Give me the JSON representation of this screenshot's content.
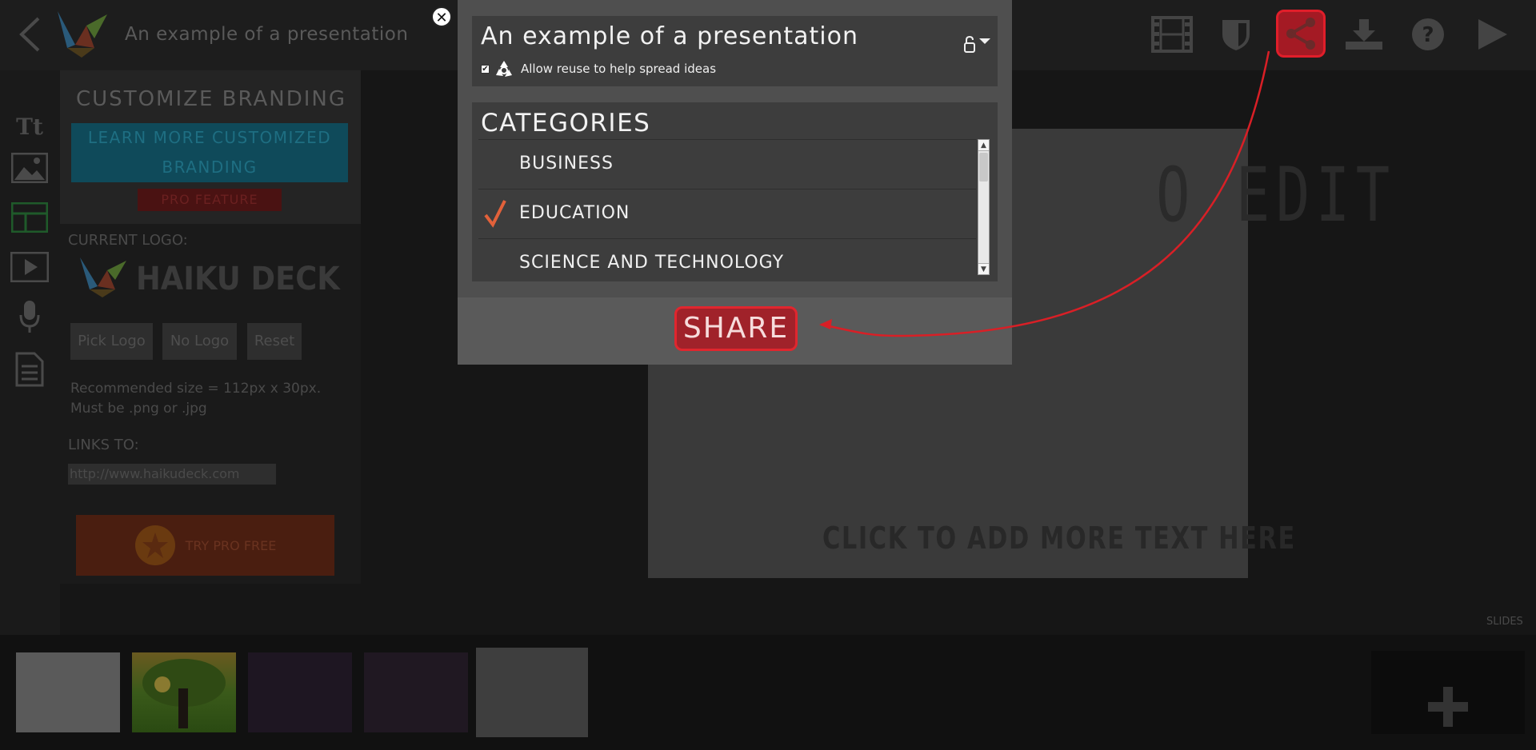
{
  "header": {
    "title": "An example of a presentation",
    "icons": [
      "back-icon",
      "haiku-deck-logo",
      "film-strip-icon",
      "pro-shield-icon",
      "share-icon",
      "download-icon",
      "help-icon",
      "play-icon"
    ]
  },
  "branding": {
    "title": "CUSTOMIZE BRANDING",
    "learn_more": "LEARN MORE CUSTOMIZED BRANDING",
    "pro_feature": "PRO FEATURE",
    "current_logo_label": "CURRENT LOGO:",
    "logo_text": "HAIKU DECK",
    "buttons": {
      "pick": "Pick Logo",
      "none": "No Logo",
      "reset": "Reset"
    },
    "recommended": "Recommended size = 112px x 30px.",
    "format": "Must be .png or .jpg",
    "links_to_label": "LINKS TO:",
    "url_value": "http://www.haikudeck.com",
    "try_pro": "TRY PRO FREE"
  },
  "slide": {
    "title_fragment": "O EDIT",
    "subtitle": "CLICK TO ADD MORE TEXT HERE"
  },
  "slides_label": "SLIDES",
  "modal": {
    "presentation_title": "An example of a presentation",
    "reuse_label": "Allow reuse to help spread ideas",
    "reuse_checked": true,
    "categories_title": "CATEGORIES",
    "categories": [
      {
        "label": "BUSINESS",
        "selected": false
      },
      {
        "label": "EDUCATION",
        "selected": true
      },
      {
        "label": "SCIENCE AND TECHNOLOGY",
        "selected": false
      }
    ],
    "share_label": "SHARE"
  },
  "colors": {
    "accent_red": "#e0262e",
    "check_orange": "#e2613a",
    "modal_bg": "#4f4f4f"
  }
}
